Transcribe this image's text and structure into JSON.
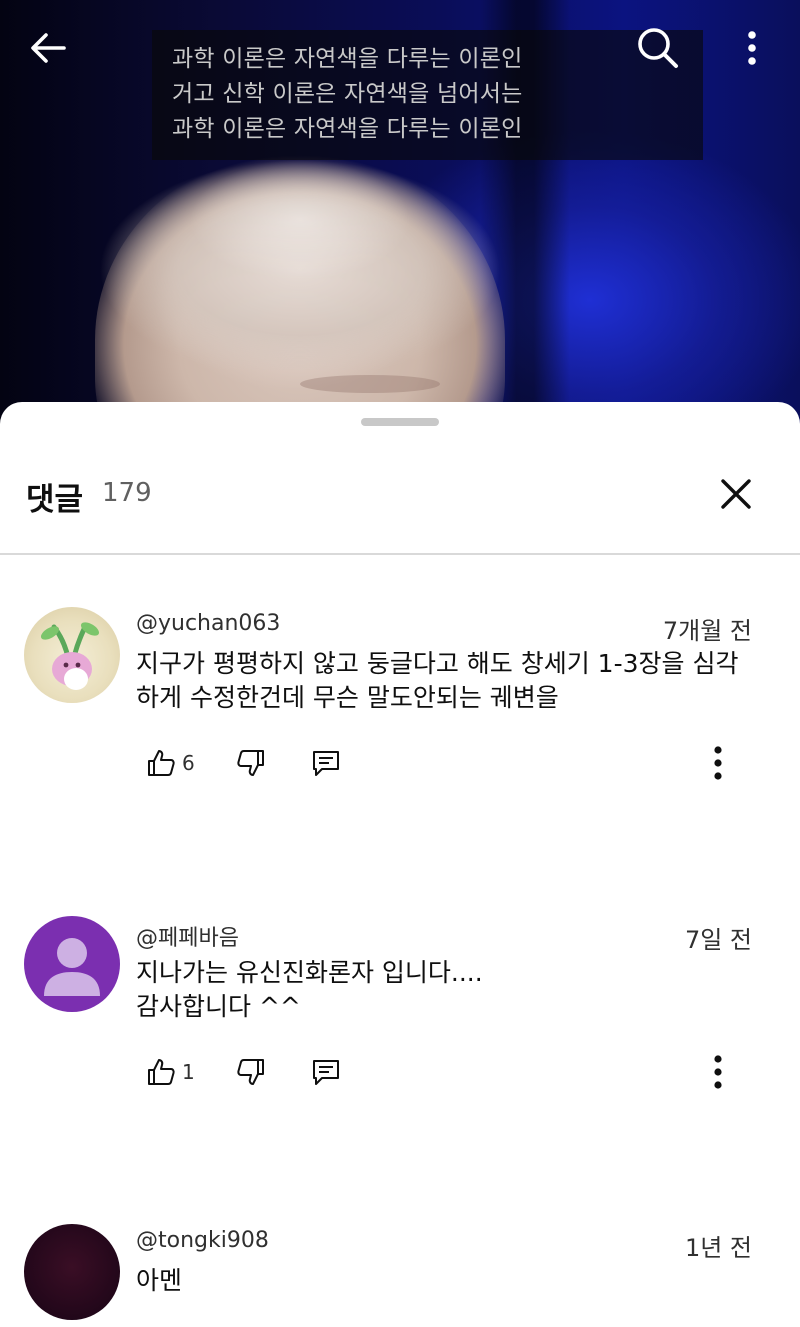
{
  "video": {
    "captions": [
      "과학 이론은 자연색을 다루는 이론인",
      "거고 신학 이론은 자연색을 넘어서는",
      "과학 이론은 자연색을 다루는 이론인"
    ],
    "icons": {
      "back": "arrow-left-icon",
      "search": "search-icon",
      "more": "more-vertical-icon"
    }
  },
  "comments_panel": {
    "title": "댓글",
    "count": "179",
    "close_icon": "close-icon"
  },
  "comments": [
    {
      "author": "@yuchan063",
      "time": "7개월 전",
      "text": "지구가 평평하지 않고 둥글다고 해도 창세기 1-3장을 심각\n하게 수정한건데 무슨 말도안되는 궤변을",
      "likes": "6",
      "avatar": "photo-avatar"
    },
    {
      "author": "@페페바음",
      "time": "7일 전",
      "text": "지나가는 유신진화론자 입니다....\n감사합니다 ^^",
      "likes": "1",
      "avatar": "default-user-avatar",
      "avatar_color": "#7b2fb0"
    },
    {
      "author": "@tongki908",
      "time": "1년 전",
      "text": "아멘",
      "avatar": "dark-avatar",
      "avatar_color": "#2a0a1a"
    }
  ]
}
